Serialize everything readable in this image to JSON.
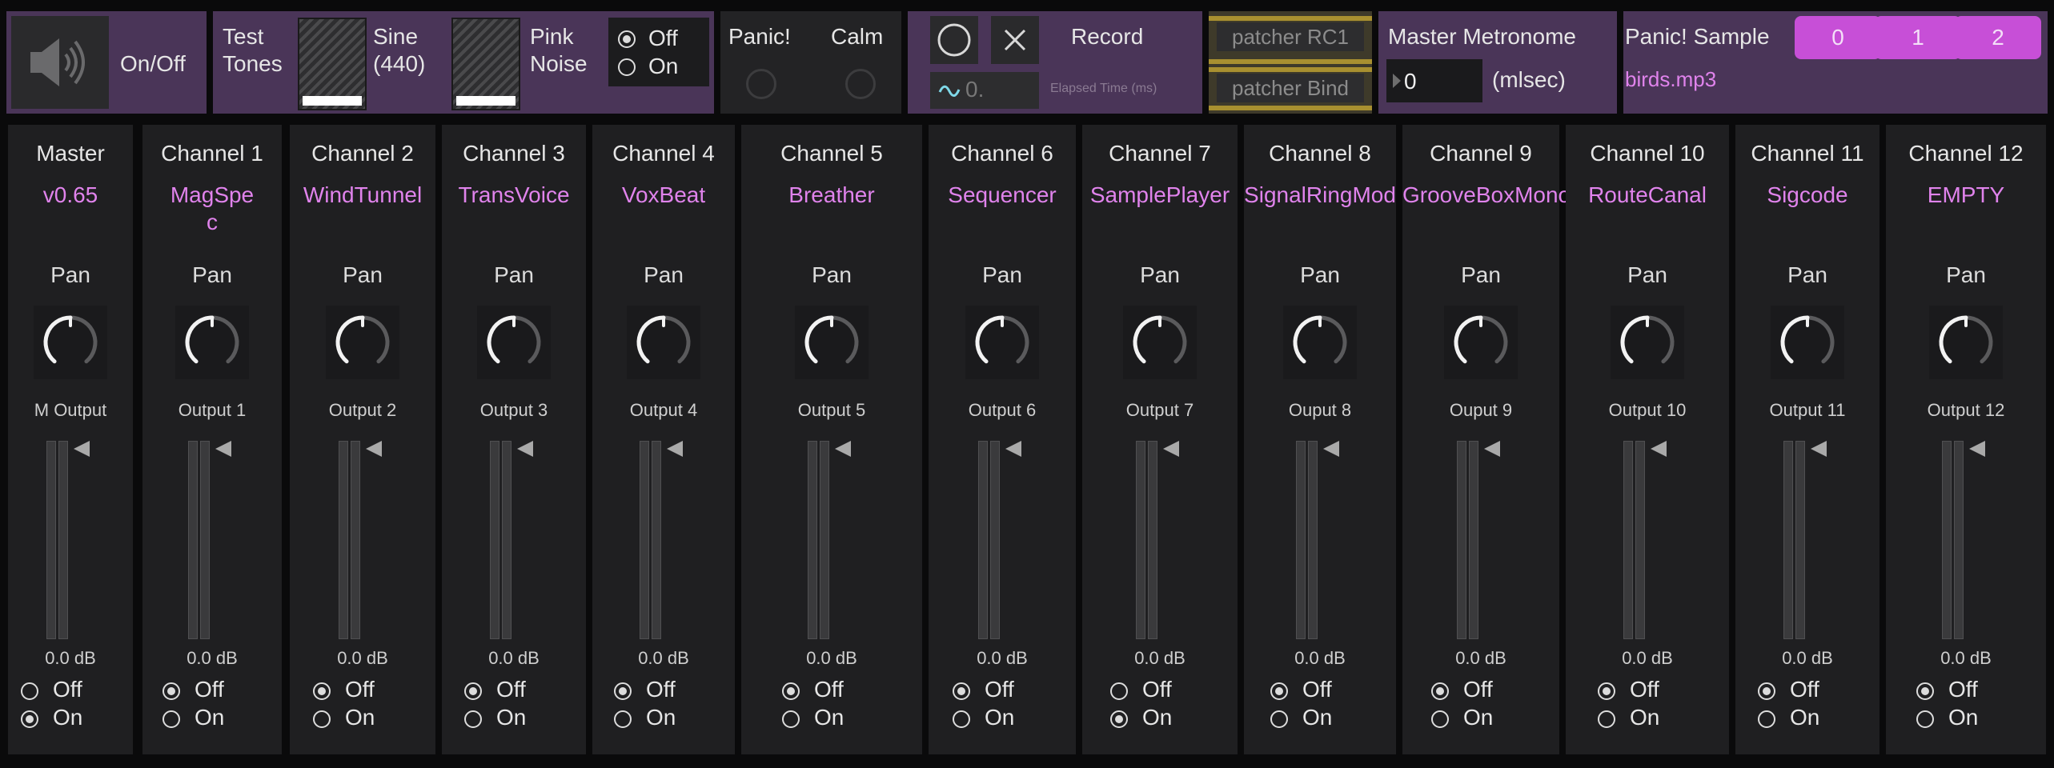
{
  "top": {
    "onoff": {
      "label": "On/Off",
      "icon": "speaker-icon"
    },
    "test_tones": {
      "label_line1": "Test",
      "label_line2": "Tones",
      "sine_line1": "Sine",
      "sine_line2": "(440)",
      "pink_line1": "Pink",
      "pink_line2": "Noise",
      "off_label": "Off",
      "on_label": "On",
      "selected": "Off"
    },
    "panic": {
      "panic_label": "Panic!",
      "calm_label": "Calm"
    },
    "record": {
      "label": "Record",
      "value": "0.",
      "elapsed_label": "Elapsed Time (ms)"
    },
    "patchers": [
      "patcher RC1",
      "patcher Bind"
    ],
    "metronome": {
      "label": "Master Metronome",
      "value": "0",
      "unit": "(mlsec)"
    },
    "panic_sample": {
      "label": "Panic! Sample",
      "file": "birds.mp3",
      "buttons": [
        "0",
        "1",
        "2"
      ]
    }
  },
  "colors": {
    "accent": "#e083ec",
    "panel_purple": "#4a3558",
    "button_magenta": "#c74fd7"
  },
  "channels": [
    {
      "title": "Master",
      "name": "v0.65",
      "pan": "Pan",
      "output": "M Output",
      "db": "0.0 dB",
      "off": "Off",
      "on": "On",
      "selected": "On"
    },
    {
      "title": "Channel 1",
      "name": "MagSpe",
      "name2": "c",
      "pan": "Pan",
      "output": "Output 1",
      "db": "0.0 dB",
      "off": "Off",
      "on": "On",
      "selected": "Off"
    },
    {
      "title": "Channel 2",
      "name": "WindTunnel",
      "pan": "Pan",
      "output": "Output 2",
      "db": "0.0 dB",
      "off": "Off",
      "on": "On",
      "selected": "Off"
    },
    {
      "title": "Channel 3",
      "name": "TransVoice",
      "pan": "Pan",
      "output": "Output 3",
      "db": "0.0 dB",
      "off": "Off",
      "on": "On",
      "selected": "Off"
    },
    {
      "title": "Channel 4",
      "name": "VoxBeat",
      "pan": "Pan",
      "output": "Output 4",
      "db": "0.0 dB",
      "off": "Off",
      "on": "On",
      "selected": "Off"
    },
    {
      "title": "Channel 5",
      "name": "Breather",
      "pan": "Pan",
      "output": "Output 5",
      "db": "0.0 dB",
      "off": "Off",
      "on": "On",
      "selected": "Off"
    },
    {
      "title": "Channel 6",
      "name": "Sequencer",
      "pan": "Pan",
      "output": "Output 6",
      "db": "0.0 dB",
      "off": "Off",
      "on": "On",
      "selected": "Off"
    },
    {
      "title": "Channel 7",
      "name": "SamplePlayer",
      "pan": "Pan",
      "output": "Output 7",
      "db": "0.0 dB",
      "off": "Off",
      "on": "On",
      "selected": "On"
    },
    {
      "title": "Channel 8",
      "name": "SignalRingMod",
      "pan": "Pan",
      "output": "Ouput 8",
      "db": "0.0 dB",
      "off": "Off",
      "on": "On",
      "selected": "Off"
    },
    {
      "title": "Channel 9",
      "name": "GrooveBoxMono",
      "pan": "Pan",
      "output": "Ouput 9",
      "db": "0.0 dB",
      "off": "Off",
      "on": "On",
      "selected": "Off"
    },
    {
      "title": "Channel 10",
      "name": "RouteCanal",
      "pan": "Pan",
      "output": "Output 10",
      "db": "0.0 dB",
      "off": "Off",
      "on": "On",
      "selected": "Off"
    },
    {
      "title": "Channel 11",
      "name": "Sigcode",
      "pan": "Pan",
      "output": "Output 11",
      "db": "0.0 dB",
      "off": "Off",
      "on": "On",
      "selected": "Off"
    },
    {
      "title": "Channel 12",
      "name": "EMPTY",
      "pan": "Pan",
      "output": "Output 12",
      "db": "0.0 dB",
      "off": "Off",
      "on": "On",
      "selected": "Off"
    }
  ]
}
